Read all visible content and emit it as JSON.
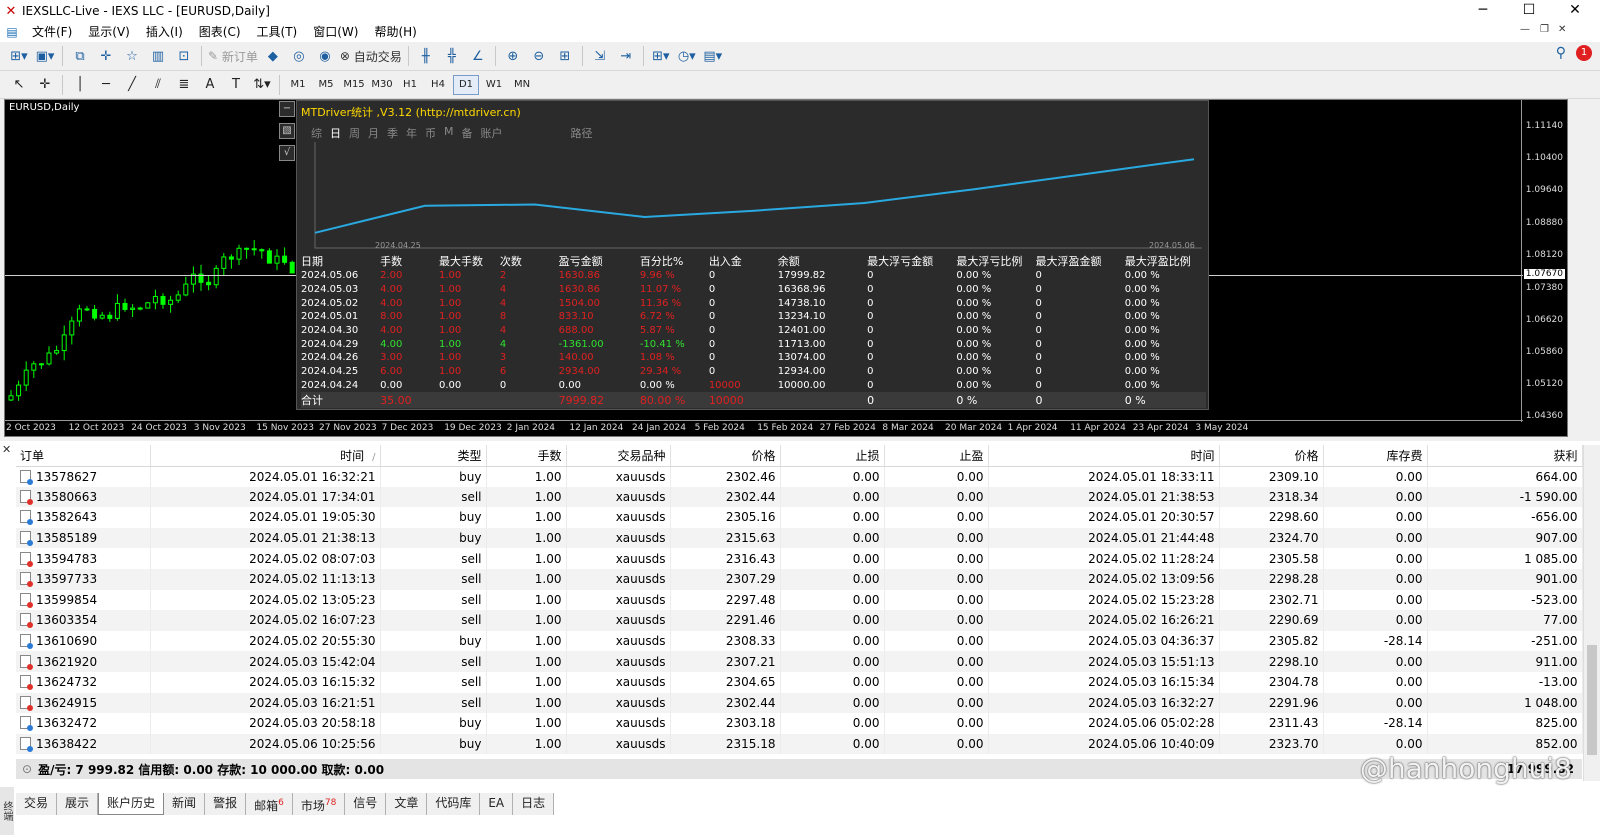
{
  "window": {
    "title": "IEXSLLC-Live - IEXS LLC - [EURUSD,Daily]",
    "minimize": "─",
    "maximize": "☐",
    "close": "✕"
  },
  "menu": [
    "文件(F)",
    "显示(V)",
    "插入(I)",
    "图表(C)",
    "工具(T)",
    "窗口(W)",
    "帮助(H)"
  ],
  "toolbar": {
    "new_order": "新订单",
    "auto_trade": "自动交易",
    "notification_count": "1"
  },
  "timeframes": [
    "M1",
    "M5",
    "M15",
    "M30",
    "H1",
    "H4",
    "D1",
    "W1",
    "MN"
  ],
  "active_timeframe": "D1",
  "chart": {
    "symbol_label": "EURUSD,Daily",
    "price_ticks": [
      "1.11140",
      "1.10400",
      "1.09640",
      "1.08880",
      "1.08120",
      "1.07380",
      "1.06620",
      "1.05860",
      "1.05120",
      "1.04360"
    ],
    "current_price": "1.07670",
    "date_ticks": [
      "2 Oct 2023",
      "12 Oct 2023",
      "24 Oct 2023",
      "3 Nov 2023",
      "15 Nov 2023",
      "27 Nov 2023",
      "7 Dec 2023",
      "19 Dec 2023",
      "2 Jan 2024",
      "12 Jan 2024",
      "24 Jan 2024",
      "5 Feb 2024",
      "15 Feb 2024",
      "27 Feb 2024",
      "8 Mar 2024",
      "20 Mar 2024",
      "1 Apr 2024",
      "11 Apr 2024",
      "23 Apr 2024",
      "3 May 2024"
    ],
    "candle_color": "#00ff00"
  },
  "mtdriver": {
    "title": "MTDriver统计 ,V3.12 (http://mtdriver.cn)",
    "tabs": [
      "综",
      "日",
      "周",
      "月",
      "季",
      "年",
      "币",
      "M",
      "备",
      "账户",
      "路径"
    ],
    "active_tab": "日",
    "side_buttons": [
      "−",
      "▧",
      "√"
    ],
    "equity_start_label": "2024.04.25",
    "equity_end_label": "2024.05.06",
    "equity_curve": [
      10000.0,
      12934.0,
      13074.0,
      11713.0,
      12401.0,
      13234.1,
      14738.1,
      16368.96,
      17999.82
    ],
    "line_color": "#29a9e0",
    "headers": [
      "日期",
      "手数",
      "最大手数",
      "次数",
      "盈亏金额",
      "百分比%",
      "出入金",
      "余额",
      "最大浮亏金额",
      "最大浮亏比例",
      "最大浮盈金额",
      "最大浮盈比例"
    ],
    "rows": [
      {
        "date": "2024.05.06",
        "lots": "2.00",
        "max_lots": "1.00",
        "count": "2",
        "pnl": "1630.86",
        "pct": "9.96 %",
        "io": "0",
        "balance": "17999.82",
        "mfl": "0",
        "mflp": "0.00 %",
        "mfp": "0",
        "mfpp": "0.00 %",
        "color": "red"
      },
      {
        "date": "2024.05.03",
        "lots": "4.00",
        "max_lots": "1.00",
        "count": "4",
        "pnl": "1630.86",
        "pct": "11.07 %",
        "io": "0",
        "balance": "16368.96",
        "mfl": "0",
        "mflp": "0.00 %",
        "mfp": "0",
        "mfpp": "0.00 %",
        "color": "red"
      },
      {
        "date": "2024.05.02",
        "lots": "4.00",
        "max_lots": "1.00",
        "count": "4",
        "pnl": "1504.00",
        "pct": "11.36 %",
        "io": "0",
        "balance": "14738.10",
        "mfl": "0",
        "mflp": "0.00 %",
        "mfp": "0",
        "mfpp": "0.00 %",
        "color": "red"
      },
      {
        "date": "2024.05.01",
        "lots": "8.00",
        "max_lots": "1.00",
        "count": "8",
        "pnl": "833.10",
        "pct": "6.72 %",
        "io": "0",
        "balance": "13234.10",
        "mfl": "0",
        "mflp": "0.00 %",
        "mfp": "0",
        "mfpp": "0.00 %",
        "color": "red"
      },
      {
        "date": "2024.04.30",
        "lots": "4.00",
        "max_lots": "1.00",
        "count": "4",
        "pnl": "688.00",
        "pct": "5.87 %",
        "io": "0",
        "balance": "12401.00",
        "mfl": "0",
        "mflp": "0.00 %",
        "mfp": "0",
        "mfpp": "0.00 %",
        "color": "red"
      },
      {
        "date": "2024.04.29",
        "lots": "4.00",
        "max_lots": "1.00",
        "count": "4",
        "pnl": "-1361.00",
        "pct": "-10.41 %",
        "io": "0",
        "balance": "11713.00",
        "mfl": "0",
        "mflp": "0.00 %",
        "mfp": "0",
        "mfpp": "0.00 %",
        "color": "green"
      },
      {
        "date": "2024.04.26",
        "lots": "3.00",
        "max_lots": "1.00",
        "count": "3",
        "pnl": "140.00",
        "pct": "1.08 %",
        "io": "0",
        "balance": "13074.00",
        "mfl": "0",
        "mflp": "0.00 %",
        "mfp": "0",
        "mfpp": "0.00 %",
        "color": "red"
      },
      {
        "date": "2024.04.25",
        "lots": "6.00",
        "max_lots": "1.00",
        "count": "6",
        "pnl": "2934.00",
        "pct": "29.34 %",
        "io": "0",
        "balance": "12934.00",
        "mfl": "0",
        "mflp": "0.00 %",
        "mfp": "0",
        "mfpp": "0.00 %",
        "color": "red"
      },
      {
        "date": "2024.04.24",
        "lots": "0.00",
        "max_lots": "0.00",
        "count": "0",
        "pnl": "0.00",
        "pct": "0.00 %",
        "io": "10000",
        "balance": "10000.00",
        "mfl": "0",
        "mflp": "0.00 %",
        "mfp": "0",
        "mfpp": "0.00 %",
        "color": "none"
      }
    ],
    "total": {
      "label": "合计",
      "lots": "35.00",
      "pnl": "7999.82",
      "pct": "80.00 %",
      "io": "10000",
      "mfl": "0",
      "mflp": "0 %",
      "mfp": "0",
      "mfpp": "0 %"
    }
  },
  "history": {
    "headers": [
      "订单",
      "时间",
      "类型",
      "手数",
      "交易品种",
      "价格",
      "止损",
      "止盈",
      "时间",
      "价格",
      "库存费",
      "获利"
    ],
    "sort_indicator": "/",
    "rows": [
      [
        "13578627",
        "2024.05.01 16:32:21",
        "buy",
        "1.00",
        "xauusds",
        "2302.46",
        "0.00",
        "0.00",
        "2024.05.01 18:33:11",
        "2309.10",
        "0.00",
        "664.00"
      ],
      [
        "13580663",
        "2024.05.01 17:34:01",
        "sell",
        "1.00",
        "xauusds",
        "2302.44",
        "0.00",
        "0.00",
        "2024.05.01 21:38:53",
        "2318.34",
        "0.00",
        "-1 590.00"
      ],
      [
        "13582643",
        "2024.05.01 19:05:30",
        "buy",
        "1.00",
        "xauusds",
        "2305.16",
        "0.00",
        "0.00",
        "2024.05.01 20:30:57",
        "2298.60",
        "0.00",
        "-656.00"
      ],
      [
        "13585189",
        "2024.05.01 21:38:13",
        "buy",
        "1.00",
        "xauusds",
        "2315.63",
        "0.00",
        "0.00",
        "2024.05.01 21:44:48",
        "2324.70",
        "0.00",
        "907.00"
      ],
      [
        "13594783",
        "2024.05.02 08:07:03",
        "sell",
        "1.00",
        "xauusds",
        "2316.43",
        "0.00",
        "0.00",
        "2024.05.02 11:28:24",
        "2305.58",
        "0.00",
        "1 085.00"
      ],
      [
        "13597733",
        "2024.05.02 11:13:13",
        "sell",
        "1.00",
        "xauusds",
        "2307.29",
        "0.00",
        "0.00",
        "2024.05.02 13:09:56",
        "2298.28",
        "0.00",
        "901.00"
      ],
      [
        "13599854",
        "2024.05.02 13:05:23",
        "sell",
        "1.00",
        "xauusds",
        "2297.48",
        "0.00",
        "0.00",
        "2024.05.02 15:23:28",
        "2302.71",
        "0.00",
        "-523.00"
      ],
      [
        "13603354",
        "2024.05.02 16:07:23",
        "sell",
        "1.00",
        "xauusds",
        "2291.46",
        "0.00",
        "0.00",
        "2024.05.02 16:26:21",
        "2290.69",
        "0.00",
        "77.00"
      ],
      [
        "13610690",
        "2024.05.02 20:55:30",
        "buy",
        "1.00",
        "xauusds",
        "2308.33",
        "0.00",
        "0.00",
        "2024.05.03 04:36:37",
        "2305.82",
        "-28.14",
        "-251.00"
      ],
      [
        "13621920",
        "2024.05.03 15:42:04",
        "sell",
        "1.00",
        "xauusds",
        "2307.21",
        "0.00",
        "0.00",
        "2024.05.03 15:51:13",
        "2298.10",
        "0.00",
        "911.00"
      ],
      [
        "13624732",
        "2024.05.03 16:15:32",
        "sell",
        "1.00",
        "xauusds",
        "2304.65",
        "0.00",
        "0.00",
        "2024.05.03 16:15:34",
        "2304.78",
        "0.00",
        "-13.00"
      ],
      [
        "13624915",
        "2024.05.03 16:21:51",
        "sell",
        "1.00",
        "xauusds",
        "2302.44",
        "0.00",
        "0.00",
        "2024.05.03 16:32:27",
        "2291.96",
        "0.00",
        "1 048.00"
      ],
      [
        "13632472",
        "2024.05.03 20:58:18",
        "buy",
        "1.00",
        "xauusds",
        "2303.18",
        "0.00",
        "0.00",
        "2024.05.06 05:02:28",
        "2311.43",
        "-28.14",
        "825.00"
      ],
      [
        "13638422",
        "2024.05.06 10:25:56",
        "buy",
        "1.00",
        "xauusds",
        "2315.18",
        "0.00",
        "0.00",
        "2024.05.06 10:40:09",
        "2323.70",
        "0.00",
        "852.00"
      ]
    ],
    "summary": "盈/亏: 7 999.82  信用额: 0.00  存款: 10 000.00  取款: 0.00",
    "summary_total": "17 999.82"
  },
  "bottom_tabs": [
    {
      "label": "交易",
      "count": ""
    },
    {
      "label": "展示",
      "count": ""
    },
    {
      "label": "账户历史",
      "count": ""
    },
    {
      "label": "新闻",
      "count": ""
    },
    {
      "label": "警报",
      "count": ""
    },
    {
      "label": "邮箱",
      "count": "6"
    },
    {
      "label": "市场",
      "count": "78"
    },
    {
      "label": "信号",
      "count": ""
    },
    {
      "label": "文章",
      "count": ""
    },
    {
      "label": "代码库",
      "count": ""
    },
    {
      "label": "EA",
      "count": ""
    },
    {
      "label": "日志",
      "count": ""
    }
  ],
  "active_bottom_tab": "账户历史",
  "side_panel_label": "终端",
  "watermark": "@hanhonghui8"
}
